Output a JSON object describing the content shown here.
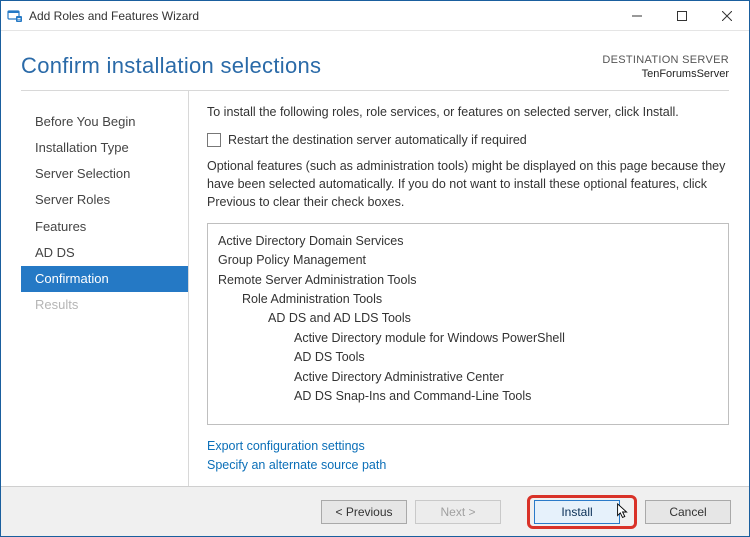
{
  "window": {
    "title": "Add Roles and Features Wizard"
  },
  "header": {
    "page_title": "Confirm installation selections",
    "dest_label": "DESTINATION SERVER",
    "dest_value": "TenForumsServer"
  },
  "sidebar": {
    "items": [
      {
        "label": "Before You Begin",
        "state": "normal"
      },
      {
        "label": "Installation Type",
        "state": "normal"
      },
      {
        "label": "Server Selection",
        "state": "normal"
      },
      {
        "label": "Server Roles",
        "state": "normal"
      },
      {
        "label": "Features",
        "state": "normal"
      },
      {
        "label": "AD DS",
        "state": "normal"
      },
      {
        "label": "Confirmation",
        "state": "active"
      },
      {
        "label": "Results",
        "state": "disabled"
      }
    ]
  },
  "content": {
    "instruction": "To install the following roles, role services, or features on selected server, click Install.",
    "restart_label": "Restart the destination server automatically if required",
    "restart_checked": false,
    "optional_text": "Optional features (such as administration tools) might be displayed on this page because they have been selected automatically. If you do not want to install these optional features, click Previous to clear their check boxes.",
    "features": [
      {
        "label": "Active Directory Domain Services",
        "indent": 0
      },
      {
        "label": "Group Policy Management",
        "indent": 0
      },
      {
        "label": "Remote Server Administration Tools",
        "indent": 0
      },
      {
        "label": "Role Administration Tools",
        "indent": 1
      },
      {
        "label": "AD DS and AD LDS Tools",
        "indent": 2
      },
      {
        "label": "Active Directory module for Windows PowerShell",
        "indent": 3
      },
      {
        "label": "AD DS Tools",
        "indent": 3
      },
      {
        "label": "Active Directory Administrative Center",
        "indent": 4
      },
      {
        "label": "AD DS Snap-Ins and Command-Line Tools",
        "indent": 4
      }
    ],
    "links": {
      "export": "Export configuration settings",
      "alt_source": "Specify an alternate source path"
    }
  },
  "footer": {
    "previous": "< Previous",
    "next": "Next >",
    "install": "Install",
    "cancel": "Cancel"
  }
}
